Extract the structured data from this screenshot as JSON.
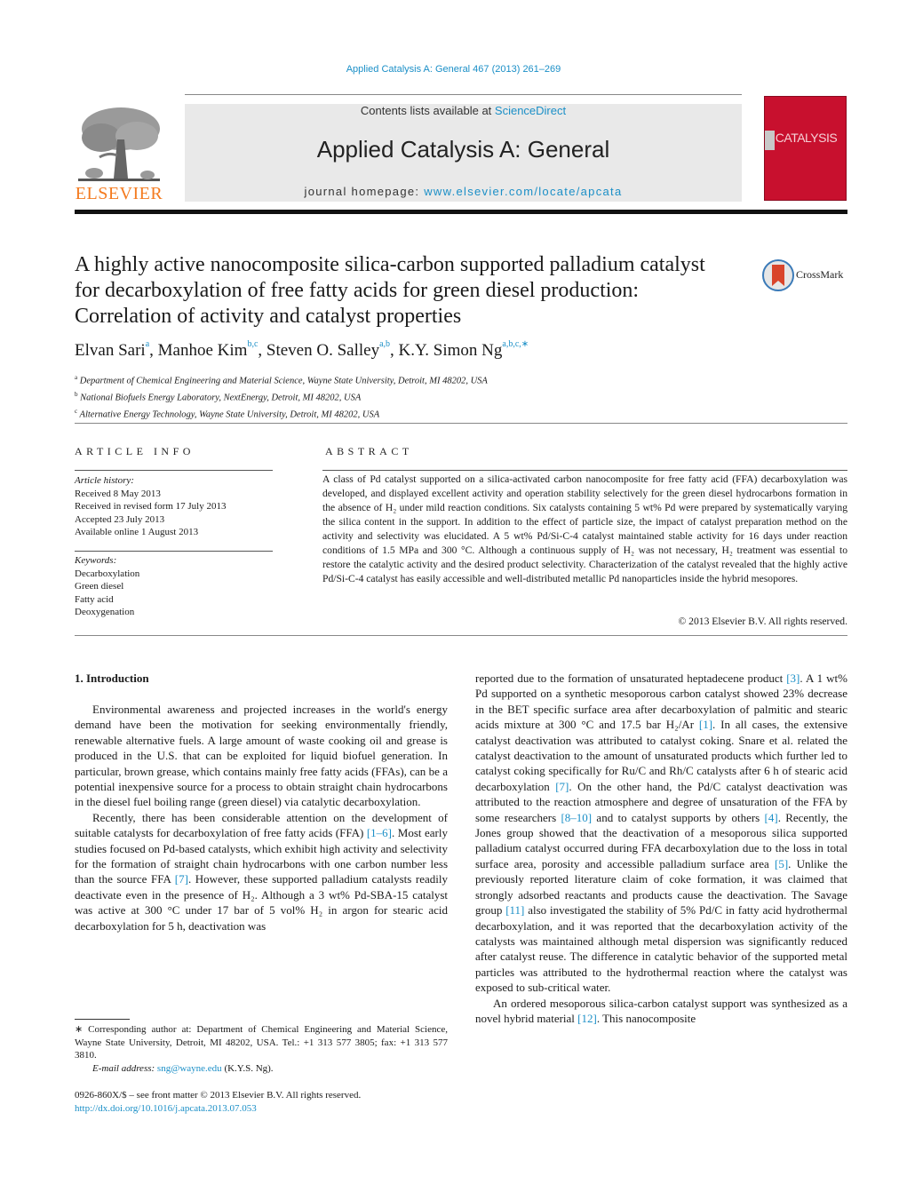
{
  "header": {
    "journal_reference": "Applied Catalysis A: General 467 (2013) 261–269",
    "contents_prefix": "Contents lists available at ",
    "contents_link": "ScienceDirect",
    "journal_title": "Applied Catalysis A: General",
    "homepage_prefix": "journal homepage: ",
    "homepage_link": "www.elsevier.com/locate/apcata",
    "publisher_logo_text": "ELSEVIER",
    "cover_title": "CATALYSIS",
    "crossmark_label": "CrossMark",
    "colors": {
      "link": "#1b8fc7",
      "elsevier_orange": "#f47b20",
      "cover_red": "#c8102e"
    }
  },
  "article": {
    "title": "A highly active nanocomposite silica-carbon supported palladium catalyst for decarboxylation of free fatty acids for green diesel production: Correlation of activity and catalyst properties",
    "authors": [
      {
        "name": "Elvan Sari",
        "aff": "a"
      },
      {
        "name": "Manhoe Kim",
        "aff": "b,c"
      },
      {
        "name": "Steven O. Salley",
        "aff": "a,b"
      },
      {
        "name": "K.Y. Simon Ng",
        "aff": "a,b,c,∗"
      }
    ],
    "affiliations": [
      {
        "key": "a",
        "text": "Department of Chemical Engineering and Material Science, Wayne State University, Detroit, MI 48202, USA"
      },
      {
        "key": "b",
        "text": "National Biofuels Energy Laboratory, NextEnergy, Detroit, MI 48202, USA"
      },
      {
        "key": "c",
        "text": "Alternative Energy Technology, Wayne State University, Detroit, MI 48202, USA"
      }
    ]
  },
  "article_info": {
    "heading": "ARTICLE INFO",
    "history_label": "Article history:",
    "history": [
      "Received 8 May 2013",
      "Received in revised form 17 July 2013",
      "Accepted 23 July 2013",
      "Available online 1 August 2013"
    ],
    "keywords_label": "Keywords:",
    "keywords": [
      "Decarboxylation",
      "Green diesel",
      "Fatty acid",
      "Deoxygenation"
    ]
  },
  "abstract": {
    "heading": "ABSTRACT",
    "text": "A class of Pd catalyst supported on a silica-activated carbon nanocomposite for free fatty acid (FFA) decarboxylation was developed, and displayed excellent activity and operation stability selectively for the green diesel hydrocarbons formation in the absence of H₂ under mild reaction conditions. Six catalysts containing 5 wt% Pd were prepared by systematically varying the silica content in the support. In addition to the effect of particle size, the impact of catalyst preparation method on the activity and selectivity was elucidated. A 5 wt% Pd/Si-C-4 catalyst maintained stable activity for 16 days under reaction conditions of 1.5 MPa and 300 °C. Although a continuous supply of H₂ was not necessary, H₂ treatment was essential to restore the catalytic activity and the desired product selectivity. Characterization of the catalyst revealed that the highly active Pd/Si-C-4 catalyst has easily accessible and well-distributed metallic Pd nanoparticles inside the hybrid mesopores.",
    "copyright": "© 2013 Elsevier B.V. All rights reserved."
  },
  "body": {
    "section_heading": "1.  Introduction",
    "left_paragraphs": [
      [
        {
          "t": "Environmental awareness and projected increases in the world's energy demand have been the motivation for seeking environmentally friendly, renewable alternative fuels. A large amount of waste cooking oil and grease is produced in the U.S. that can be exploited for liquid biofuel generation. In particular, brown grease, which contains mainly free fatty acids (FFAs), can be a potential inexpensive source for a process to obtain straight chain hydrocarbons in the diesel fuel boiling range (green diesel) via catalytic decarboxylation."
        }
      ],
      [
        {
          "t": "Recently, there has been considerable attention on the development of suitable catalysts for decarboxylation of free fatty acids (FFA) "
        },
        {
          "ref": "[1–6]"
        },
        {
          "t": ". Most early studies focused on Pd-based catalysts, which exhibit high activity and selectivity for the formation of straight chain hydrocarbons with one carbon number less than the source FFA "
        },
        {
          "ref": "[7]"
        },
        {
          "t": ". However, these supported palladium catalysts readily deactivate even in the presence of H₂. Although a 3 wt% Pd-SBA-15 catalyst was active at 300 °C under 17 bar of 5 vol% H₂ in argon for stearic acid decarboxylation for 5 h, deactivation was"
        }
      ]
    ],
    "right_paragraphs": [
      [
        {
          "t": "reported due to the formation of unsaturated heptadecene product "
        },
        {
          "ref": "[3]"
        },
        {
          "t": ". A 1 wt% Pd supported on a synthetic mesoporous carbon catalyst showed 23% decrease in the BET specific surface area after decarboxylation of palmitic and stearic acids mixture at 300 °C and 17.5 bar H₂/Ar "
        },
        {
          "ref": "[1]"
        },
        {
          "t": ". In all cases, the extensive catalyst deactivation was attributed to catalyst coking. Snare et al. related the catalyst deactivation to the amount of unsaturated products which further led to catalyst coking specifically for Ru/C and Rh/C catalysts after 6 h of stearic acid decarboxylation "
        },
        {
          "ref": "[7]"
        },
        {
          "t": ". On the other hand, the Pd/C catalyst deactivation was attributed to the reaction atmosphere and degree of unsaturation of the FFA by some researchers "
        },
        {
          "ref": "[8–10]"
        },
        {
          "t": " and to catalyst supports by others "
        },
        {
          "ref": "[4]"
        },
        {
          "t": ". Recently, the Jones group showed that the deactivation of a mesoporous silica supported palladium catalyst occurred during FFA decarboxylation due to the loss in total surface area, porosity and accessible palladium surface area "
        },
        {
          "ref": "[5]"
        },
        {
          "t": ". Unlike the previously reported literature claim of coke formation, it was claimed that strongly adsorbed reactants and products cause the deactivation. The Savage group "
        },
        {
          "ref": "[11]"
        },
        {
          "t": " also investigated the stability of 5% Pd/C in fatty acid hydrothermal decarboxylation, and it was reported that the decarboxylation activity of the catalysts was maintained although metal dispersion was significantly reduced after catalyst reuse. The difference in catalytic behavior of the supported metal particles was attributed to the hydrothermal reaction where the catalyst was exposed to sub-critical water."
        }
      ],
      [
        {
          "t": "An ordered mesoporous silica-carbon catalyst support was synthesized as a novel hybrid material "
        },
        {
          "ref": "[12]"
        },
        {
          "t": ". This nanocomposite"
        }
      ]
    ]
  },
  "footnote": {
    "corresponding": "∗  Corresponding author at: Department of Chemical Engineering and Material Science, Wayne State University, Detroit, MI 48202, USA. Tel.: +1 313 577 3805; fax: +1 313 577 3810.",
    "email_label": "E-mail address: ",
    "email": "sng@wayne.edu",
    "email_suffix": " (K.Y.S. Ng).",
    "front_matter": "0926-860X/$ – see front matter © 2013 Elsevier B.V. All rights reserved.",
    "doi": "http://dx.doi.org/10.1016/j.apcata.2013.07.053"
  }
}
